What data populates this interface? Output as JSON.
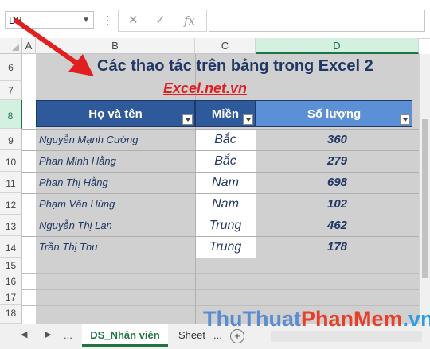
{
  "formula_bar": {
    "name_box": "D8",
    "cancel_icon": "✕",
    "enter_icon": "✓",
    "fx_label": "fx",
    "formula_value": ""
  },
  "columns": [
    "A",
    "B",
    "C",
    "D"
  ],
  "rows": [
    "6",
    "7",
    "8",
    "9",
    "10",
    "11",
    "12",
    "13",
    "14",
    "15",
    "16",
    "17",
    "18"
  ],
  "sheet": {
    "title": "Các thao tác trên bảng trong Excel 2",
    "site": "Excel.net.vn",
    "headers": [
      "Họ và tên",
      "Miền",
      "Số lượng"
    ],
    "table_rows": [
      {
        "name": "Nguyễn  Mạnh Cường",
        "region": "Bắc",
        "qty": "360"
      },
      {
        "name": "Phan  Minh Hằng",
        "region": "Bắc",
        "qty": "279"
      },
      {
        "name": "Phan  Thị Hằng",
        "region": "Nam",
        "qty": "698"
      },
      {
        "name": "Phạm  Văn Hùng",
        "region": "Nam",
        "qty": "102"
      },
      {
        "name": "Nguyễn  Thị Lan",
        "region": "Trung",
        "qty": "462"
      },
      {
        "name": "Trần  Thị Thu",
        "region": "Trung",
        "qty": "178"
      }
    ]
  },
  "tabs": {
    "more": "...",
    "active": "DS_Nhân viên",
    "other": "Sheet",
    "add": "+"
  },
  "watermark": {
    "part1": "Thu",
    "part2": "Thuat",
    "part3": "Phan",
    "part4": "Mem",
    "part5": ".vn"
  },
  "colors": {
    "header_fill": "#2e5a9c",
    "qty_header_fill": "#5b8fd6",
    "text_blue": "#1f3864",
    "accent_red": "#e02020",
    "excel_green": "#217346"
  }
}
